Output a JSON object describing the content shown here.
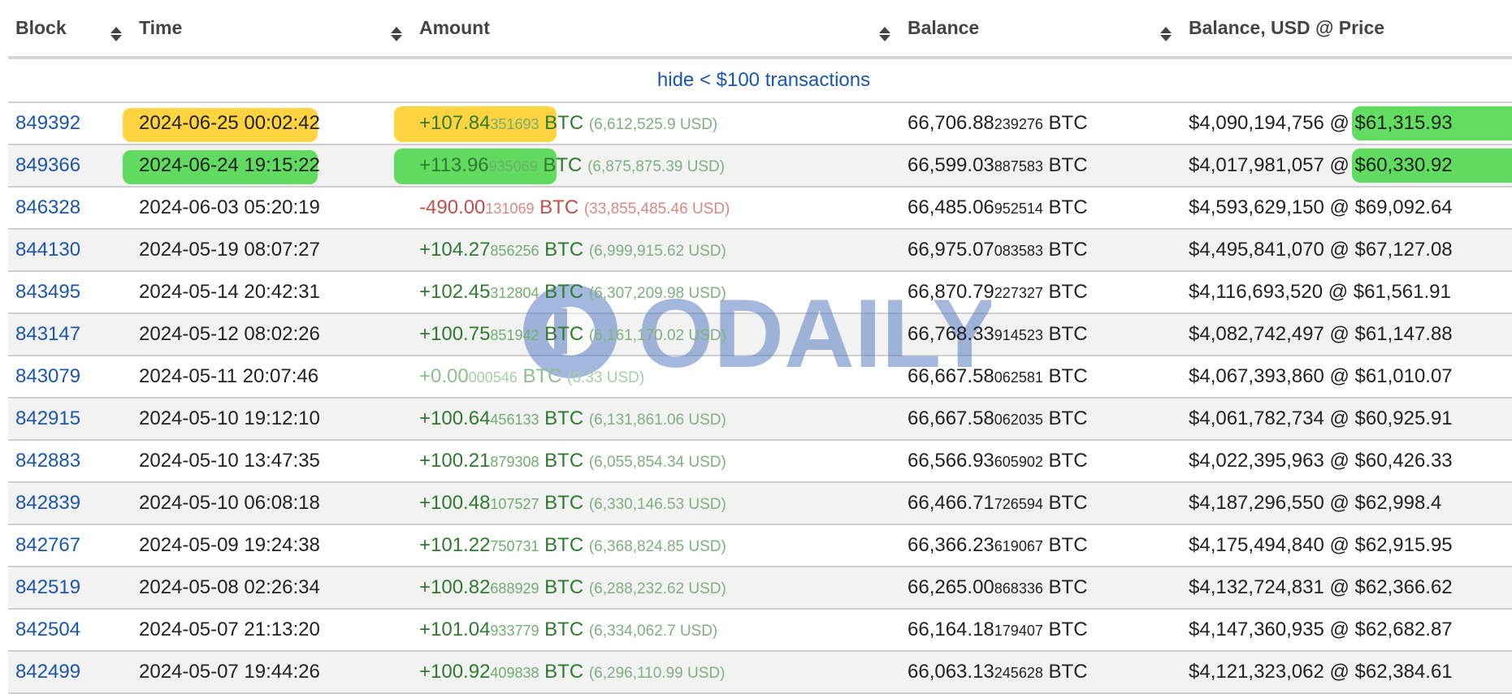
{
  "columns": {
    "block": "Block",
    "time": "Time",
    "amount": "Amount",
    "balance": "Balance",
    "balance_usd": "Balance, USD @ Price"
  },
  "hide_small_label": "hide < $100 transactions",
  "watermark_text": "ODAILY",
  "highlight_colors": {
    "yellow": "#ffcd1e",
    "green": "#46d746"
  },
  "rows": [
    {
      "block": "849392",
      "time": "2024-06-25 00:02:42",
      "amt_main": "+107.84",
      "amt_small": "351693",
      "amt_unit": " BTC ",
      "amt_usd": "(6,612,525.9 USD)",
      "bal_main": "66,706.88",
      "bal_small": "239276",
      "bal_unit": " BTC",
      "usd": "$4,090,194,756 @ ",
      "price": "$61,315.93",
      "kind": "pos"
    },
    {
      "block": "849366",
      "time": "2024-06-24 19:15:22",
      "amt_main": "+113.96",
      "amt_small": "935069",
      "amt_unit": " BTC ",
      "amt_usd": "(6,875,875.39 USD)",
      "bal_main": "66,599.03",
      "bal_small": "887583",
      "bal_unit": " BTC",
      "usd": "$4,017,981,057 @ ",
      "price": "$60,330.92",
      "kind": "pos"
    },
    {
      "block": "846328",
      "time": "2024-06-03 05:20:19",
      "amt_main": "-490.00",
      "amt_small": "131069",
      "amt_unit": " BTC ",
      "amt_usd": "(33,855,485.46 USD)",
      "bal_main": "66,485.06",
      "bal_small": "952514",
      "bal_unit": " BTC",
      "usd": "$4,593,629,150 @ ",
      "price": "$69,092.64",
      "kind": "neg"
    },
    {
      "block": "844130",
      "time": "2024-05-19 08:07:27",
      "amt_main": "+104.27",
      "amt_small": "856256",
      "amt_unit": " BTC ",
      "amt_usd": "(6,999,915.62 USD)",
      "bal_main": "66,975.07",
      "bal_small": "083583",
      "bal_unit": " BTC",
      "usd": "$4,495,841,070 @ ",
      "price": "$67,127.08",
      "kind": "pos"
    },
    {
      "block": "843495",
      "time": "2024-05-14 20:42:31",
      "amt_main": "+102.45",
      "amt_small": "312804",
      "amt_unit": " BTC ",
      "amt_usd": "(6,307,209.98 USD)",
      "bal_main": "66,870.79",
      "bal_small": "227327",
      "bal_unit": " BTC",
      "usd": "$4,116,693,520 @ ",
      "price": "$61,561.91",
      "kind": "pos"
    },
    {
      "block": "843147",
      "time": "2024-05-12 08:02:26",
      "amt_main": "+100.75",
      "amt_small": "851942",
      "amt_unit": " BTC ",
      "amt_usd": "(6,161,170.02 USD)",
      "bal_main": "66,768.33",
      "bal_small": "914523",
      "bal_unit": " BTC",
      "usd": "$4,082,742,497 @ ",
      "price": "$61,147.88",
      "kind": "pos"
    },
    {
      "block": "843079",
      "time": "2024-05-11 20:07:46",
      "amt_main": "+0.00",
      "amt_small": "000546",
      "amt_unit": " BTC ",
      "amt_usd": "(0.33 USD)",
      "bal_main": "66,667.58",
      "bal_small": "062581",
      "bal_unit": " BTC",
      "usd": "$4,067,393,860 @ ",
      "price": "$61,010.07",
      "kind": "tiny"
    },
    {
      "block": "842915",
      "time": "2024-05-10 19:12:10",
      "amt_main": "+100.64",
      "amt_small": "456133",
      "amt_unit": " BTC ",
      "amt_usd": "(6,131,861.06 USD)",
      "bal_main": "66,667.58",
      "bal_small": "062035",
      "bal_unit": " BTC",
      "usd": "$4,061,782,734 @ ",
      "price": "$60,925.91",
      "kind": "pos"
    },
    {
      "block": "842883",
      "time": "2024-05-10 13:47:35",
      "amt_main": "+100.21",
      "amt_small": "879308",
      "amt_unit": " BTC ",
      "amt_usd": "(6,055,854.34 USD)",
      "bal_main": "66,566.93",
      "bal_small": "605902",
      "bal_unit": " BTC",
      "usd": "$4,022,395,963 @ ",
      "price": "$60,426.33",
      "kind": "pos"
    },
    {
      "block": "842839",
      "time": "2024-05-10 06:08:18",
      "amt_main": "+100.48",
      "amt_small": "107527",
      "amt_unit": " BTC ",
      "amt_usd": "(6,330,146.53 USD)",
      "bal_main": "66,466.71",
      "bal_small": "726594",
      "bal_unit": " BTC",
      "usd": "$4,187,296,550 @ ",
      "price": "$62,998.4",
      "kind": "pos"
    },
    {
      "block": "842767",
      "time": "2024-05-09 19:24:38",
      "amt_main": "+101.22",
      "amt_small": "750731",
      "amt_unit": " BTC ",
      "amt_usd": "(6,368,824.85 USD)",
      "bal_main": "66,366.23",
      "bal_small": "619067",
      "bal_unit": " BTC",
      "usd": "$4,175,494,840 @ ",
      "price": "$62,915.95",
      "kind": "pos"
    },
    {
      "block": "842519",
      "time": "2024-05-08 02:26:34",
      "amt_main": "+100.82",
      "amt_small": "688929",
      "amt_unit": " BTC ",
      "amt_usd": "(6,288,232.62 USD)",
      "bal_main": "66,265.00",
      "bal_small": "868336",
      "bal_unit": " BTC",
      "usd": "$4,132,724,831 @ ",
      "price": "$62,366.62",
      "kind": "pos"
    },
    {
      "block": "842504",
      "time": "2024-05-07 21:13:20",
      "amt_main": "+101.04",
      "amt_small": "933779",
      "amt_unit": " BTC ",
      "amt_usd": "(6,334,062.7 USD)",
      "bal_main": "66,164.18",
      "bal_small": "179407",
      "bal_unit": " BTC",
      "usd": "$4,147,360,935 @ ",
      "price": "$62,682.87",
      "kind": "pos"
    },
    {
      "block": "842499",
      "time": "2024-05-07 19:44:26",
      "amt_main": "+100.92",
      "amt_small": "409838",
      "amt_unit": " BTC ",
      "amt_usd": "(6,296,110.99 USD)",
      "bal_main": "66,063.13",
      "bal_small": "245628",
      "bal_unit": " BTC",
      "usd": "$4,121,323,062 @ ",
      "price": "$62,384.61",
      "kind": "pos"
    }
  ]
}
